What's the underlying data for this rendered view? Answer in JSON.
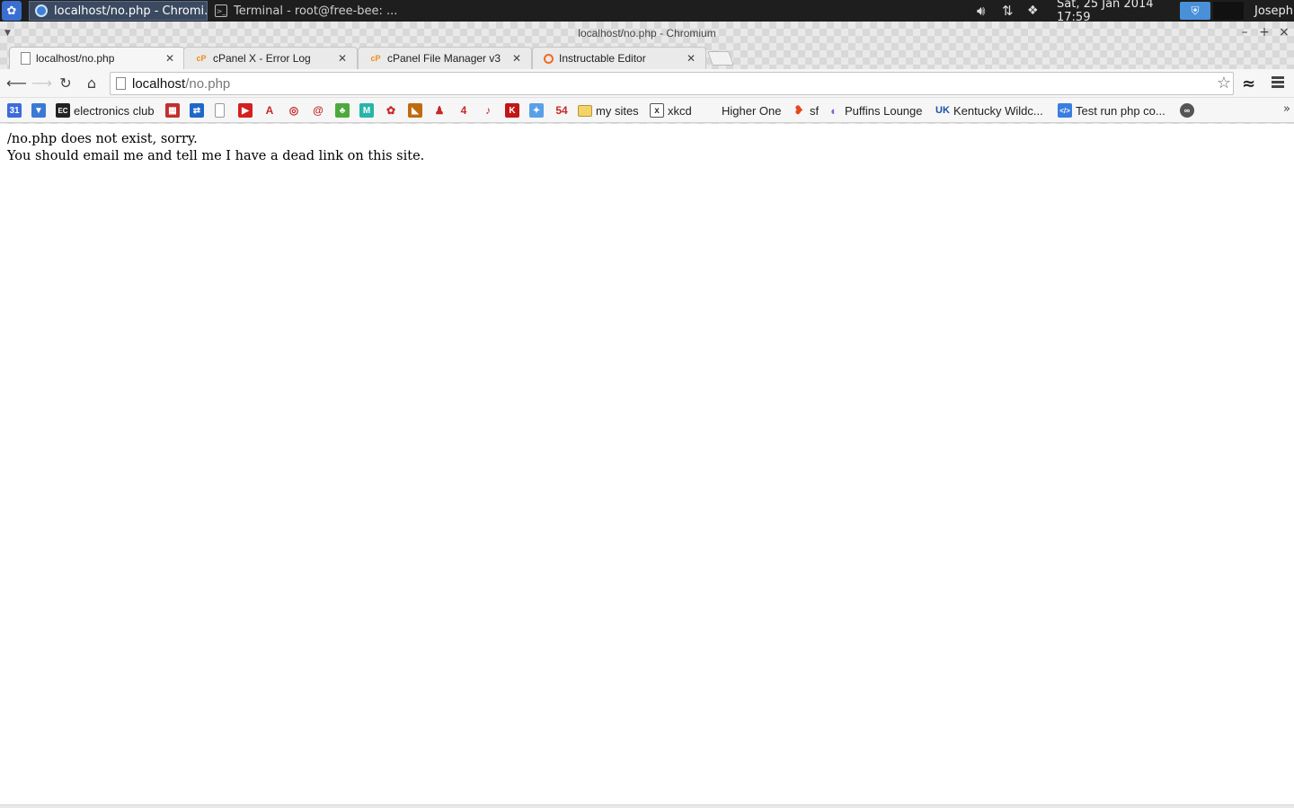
{
  "panel": {
    "tasks": [
      {
        "title": "localhost/no.php - Chromi..."
      },
      {
        "title": "Terminal - root@free-bee: ..."
      }
    ],
    "clock": "Sat, 25 Jan 2014 17:59",
    "user": "Joseph",
    "icons": [
      "app-menu-icon",
      "volume-icon",
      "network-icon",
      "dropbox-icon",
      "vpn-icon"
    ]
  },
  "window": {
    "title": "localhost/no.php - Chromium",
    "buttons": {
      "minimize": "–",
      "maximize": "+",
      "close": "×"
    }
  },
  "tabs": [
    {
      "label": "localhost/no.php",
      "favicon": "page-icon"
    },
    {
      "label": "cPanel X - Error Log",
      "favicon": "cpanel-icon"
    },
    {
      "label": "cPanel File Manager v3",
      "favicon": "cpanel-icon"
    },
    {
      "label": "Instructable Editor",
      "favicon": "instructables-icon"
    }
  ],
  "omnibox": {
    "host": "localhost",
    "path": "/no.php"
  },
  "bookmarks": [
    {
      "label": "electronics club",
      "icon": "electronics-club-icon",
      "color": "#222222"
    },
    {
      "label": "my sites",
      "icon": "folder-icon",
      "color": "#f5d36b"
    },
    {
      "label": "xkcd",
      "icon": "xkcd-icon",
      "color": "#555555"
    },
    {
      "label": "Higher One",
      "icon": "",
      "color": ""
    },
    {
      "label": "sf",
      "icon": "sourceforge-icon",
      "color": "#e8461e"
    },
    {
      "label": "Puffins Lounge",
      "icon": "puffins-icon",
      "color": "#8b5cd8"
    },
    {
      "label": "Kentucky Wildc...",
      "icon": "uk-icon",
      "color": "#1c4fa0"
    },
    {
      "label": "Test run php co...",
      "icon": "code-icon",
      "color": "#3a7ee0"
    }
  ],
  "bookmark_icons": [
    {
      "name": "google-calendar-icon",
      "color": "#3b6bdc",
      "glyph": "31"
    },
    {
      "name": "drive-icon",
      "color": "#3a79d6",
      "glyph": "▼"
    },
    {
      "name": "mobile-icon",
      "color": "#c03030",
      "glyph": "▦"
    },
    {
      "name": "blue-box-icon",
      "color": "#1e68c8",
      "glyph": "⇄"
    },
    {
      "name": "blank-page-icon",
      "color": "#ffffff",
      "glyph": ""
    },
    {
      "name": "youtube-icon",
      "color": "#d42020",
      "glyph": "▶"
    },
    {
      "name": "acrobat-icon",
      "color": "#ffffff",
      "glyph": "A"
    },
    {
      "name": "ring-icon",
      "color": "#ffffff",
      "glyph": "◎"
    },
    {
      "name": "swirl-icon",
      "color": "#ffffff",
      "glyph": "@"
    },
    {
      "name": "green-icon",
      "color": "#4caa3c",
      "glyph": "♣"
    },
    {
      "name": "maker-icon",
      "color": "#26b5a8",
      "glyph": "M"
    },
    {
      "name": "raspberry-icon",
      "color": "#ffffff",
      "glyph": "✿"
    },
    {
      "name": "orange-icon",
      "color": "#c06a10",
      "glyph": "◣"
    },
    {
      "name": "figure-icon",
      "color": "#ffffff",
      "glyph": "♟"
    },
    {
      "name": "four-icon",
      "color": "#ffffff",
      "glyph": "4"
    },
    {
      "name": "guitar-icon",
      "color": "#ffffff",
      "glyph": "♪"
    },
    {
      "name": "k-icon",
      "color": "#c01818",
      "glyph": "K"
    },
    {
      "name": "blue-blob-icon",
      "color": "#5aa0e8",
      "glyph": "✦"
    },
    {
      "name": "fifty-four-icon",
      "color": "#ffffff",
      "glyph": "54"
    }
  ],
  "page": {
    "line1": "/no.php does not exist, sorry.",
    "line2": "You should email me and tell me I have a dead link on this site."
  }
}
